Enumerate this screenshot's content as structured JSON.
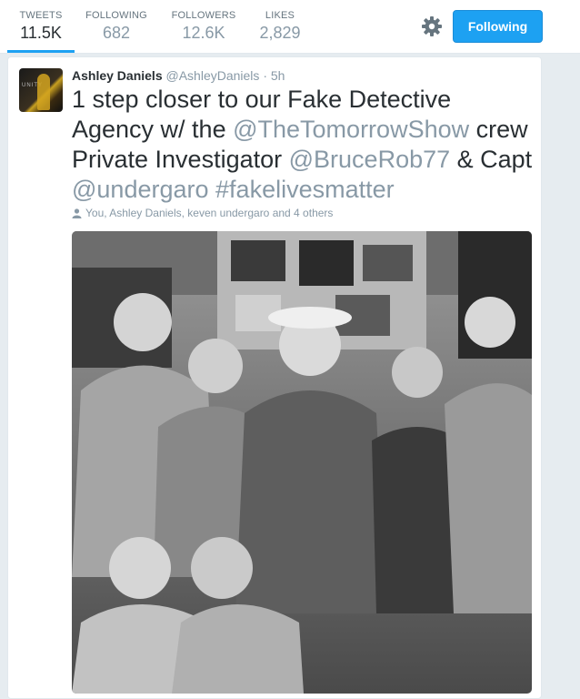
{
  "nav": {
    "stats": [
      {
        "label": "TWEETS",
        "value": "11.5K"
      },
      {
        "label": "FOLLOWING",
        "value": "682"
      },
      {
        "label": "FOLLOWERS",
        "value": "12.6K"
      },
      {
        "label": "LIKES",
        "value": "2,829"
      }
    ],
    "settings_icon": "gear-icon",
    "follow_button": "Following"
  },
  "tweet": {
    "author_name": "Ashley Daniels",
    "handle": "@AshleyDaniels",
    "separator": "·",
    "time": "5h",
    "text_parts": {
      "p1": "1 step closer to our Fake Detective Agency w/ the ",
      "m1": "@TheTomorrowShow",
      "p2": " crew Private Investigator ",
      "m2": "@BruceRob77",
      "p3": " & Capt ",
      "m3": "@undergaro",
      "p4": " ",
      "h1": "#fakelivesmatter"
    },
    "tagged": "You, Ashley Daniels, keven undergaro and 4 others",
    "tagged_icon": "person-icon"
  },
  "colors": {
    "accent": "#1da1f2",
    "link": "#8899a6",
    "text": "#292f33",
    "background": "#e6ecf0"
  }
}
